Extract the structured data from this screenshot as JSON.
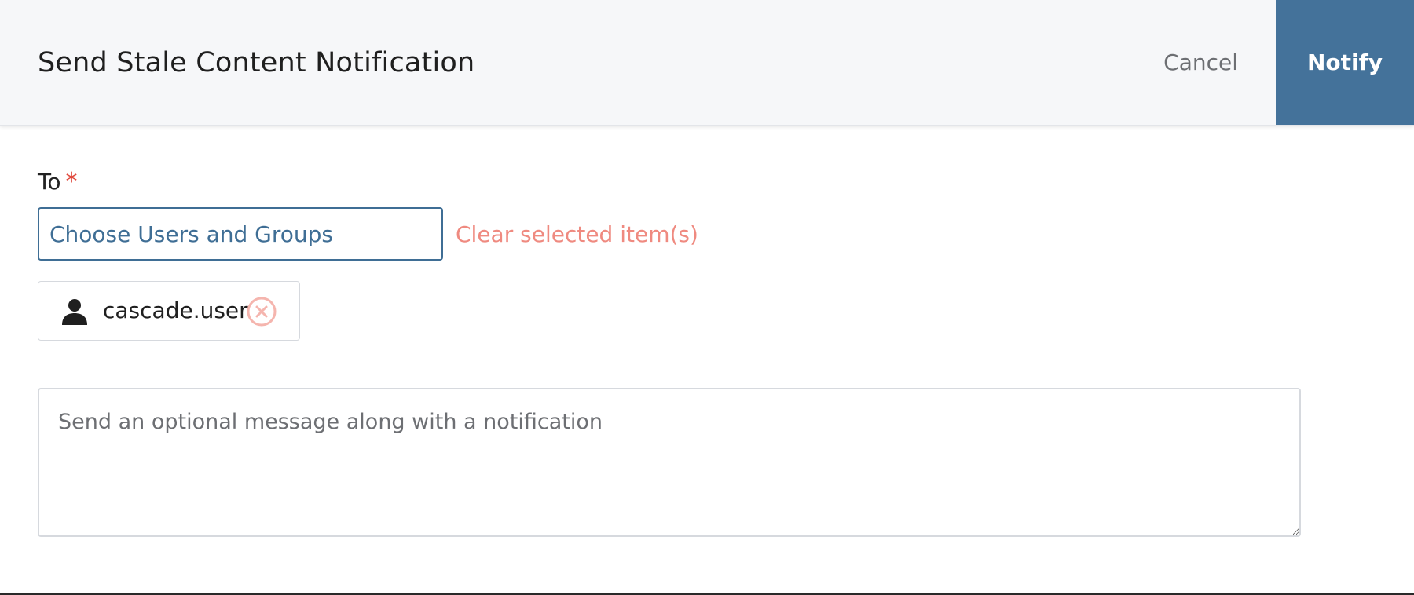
{
  "header": {
    "title": "Send Stale Content Notification",
    "cancel_label": "Cancel",
    "notify_label": "Notify",
    "notify_color": "#44729a"
  },
  "form": {
    "to_label": "To",
    "required_marker": "*",
    "chooser_label": "Choose Users and Groups",
    "clear_label": "Clear selected item(s)",
    "selected": [
      {
        "label": "cascade.user",
        "icon": "user-icon"
      }
    ],
    "message_placeholder": "Send an optional message along with a notification",
    "message_value": ""
  },
  "colors": {
    "accent": "#3f6e95",
    "danger_light": "#ef8a80",
    "required": "#e0473b"
  }
}
